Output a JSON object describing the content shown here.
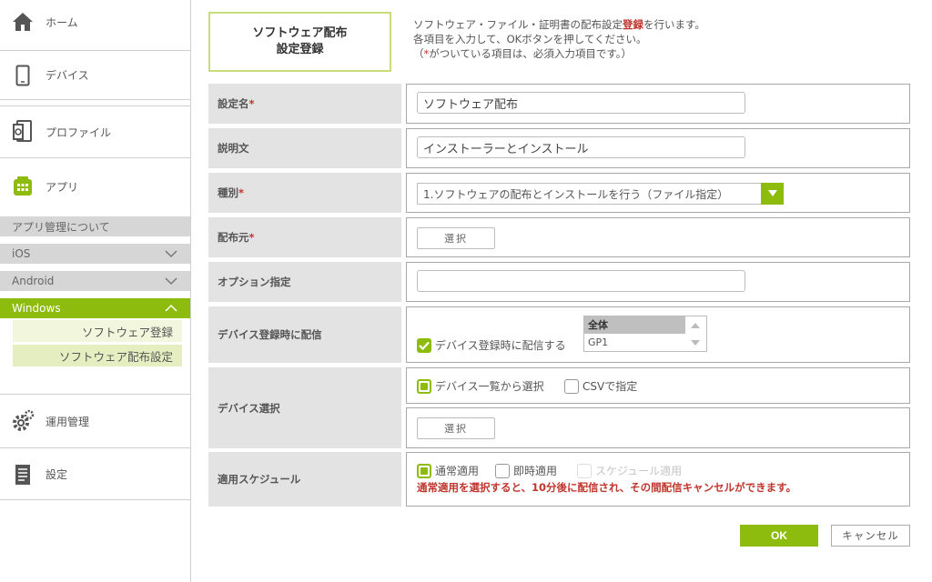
{
  "sidebar": {
    "home": "ホーム",
    "device": "デバイス",
    "profile": "プロファイル",
    "app": "アプリ",
    "app_about": "アプリ管理について",
    "ios": "iOS",
    "android": "Android",
    "windows": "Windows",
    "sw_register": "ソフトウェア登録",
    "sw_dist_setting": "ソフトウェア配布設定",
    "operation": "運用管理",
    "settings": "設定"
  },
  "header": {
    "title_line1": "ソフトウェア配布",
    "title_line2": "設定登録",
    "instr1_a": "ソフトウェア・ファイル・証明書の配布設定",
    "instr1_b": "登録",
    "instr1_c": "を行います。",
    "instr2": "各項目を入力して、OKボタンを押してください。",
    "instr3_a": "（",
    "instr3_b": "*",
    "instr3_c": "がついている項目は、必須入力項目です。）"
  },
  "form": {
    "name_label": "設定名",
    "name_value": "ソフトウェア配布",
    "desc_label": "説明文",
    "desc_value": "インストーラーとインストール",
    "type_label": "種別",
    "type_value": "1.ソフトウェアの配布とインストールを行う（ファイル指定）",
    "source_label": "配布元",
    "select_btn": "選択",
    "option_label": "オプション指定",
    "option_value": "",
    "deliver_label": "デバイス登録時に配信",
    "deliver_check": "デバイス登録時に配信する",
    "deliver_list": [
      "全体",
      "GP1"
    ],
    "devsel_label": "デバイス選択",
    "devsel_from_list": "デバイス一覧から選択",
    "devsel_csv": "CSVで指定",
    "schedule_label": "適用スケジュール",
    "sched_normal": "通常適用",
    "sched_immediate": "即時適用",
    "sched_schedule": "スケジュール適用",
    "sched_note": "通常適用を選択すると、10分後に配信され、その間配信キャンセルができます。",
    "required_mark": "*"
  },
  "buttons": {
    "ok": "OK",
    "cancel": "キャンセル"
  },
  "colors": {
    "accent": "#8dbb0e",
    "required": "#c0362c"
  }
}
